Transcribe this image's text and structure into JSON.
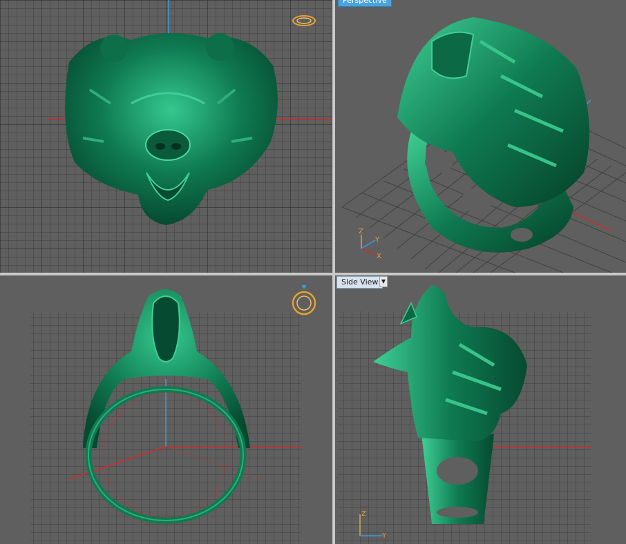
{
  "viewports": {
    "top": {
      "label": ""
    },
    "perspective": {
      "label": "Perspective"
    },
    "front": {
      "label": ""
    },
    "side": {
      "label": "Side View"
    }
  },
  "axis_labels": {
    "z": "Z",
    "x": "X",
    "y": "Y"
  },
  "colors": {
    "background": "#5f5f5f",
    "grid_line": "#3f3f3f",
    "grid_major": "#2e2e2e",
    "model_green": "#0f7a52",
    "model_highlight": "#3fcf95",
    "axis_red": "#d22a2a",
    "axis_blue": "#3a9bd6",
    "active_label": "#4aa3e0",
    "gizmo_orange": "#e5a030"
  },
  "icons": {
    "viewcube_ring": "ring-gizmo-icon",
    "dropdown": "chevron-down-icon"
  }
}
